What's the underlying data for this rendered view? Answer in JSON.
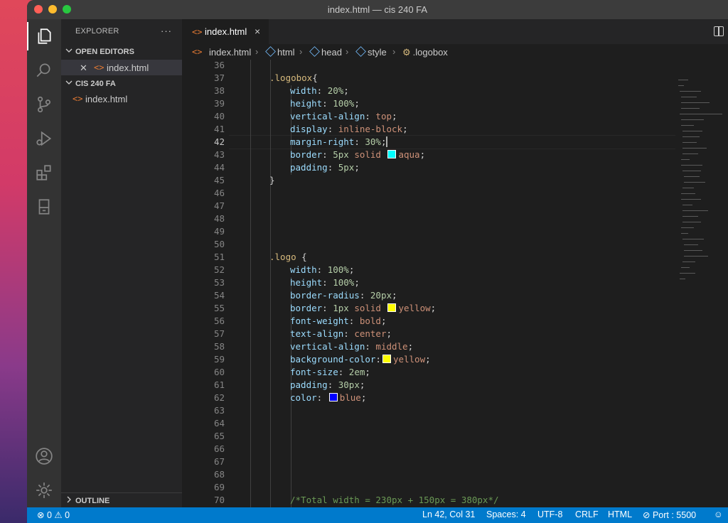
{
  "window": {
    "title": "index.html — cis 240 FA"
  },
  "activity_bar": {
    "items": [
      {
        "icon": "files-icon"
      },
      {
        "icon": "search-icon"
      },
      {
        "icon": "source-control-icon"
      },
      {
        "icon": "run-debug-icon"
      },
      {
        "icon": "extensions-icon"
      },
      {
        "icon": "remote-explorer-icon"
      }
    ],
    "bottom": [
      {
        "icon": "account-icon"
      },
      {
        "icon": "settings-gear-icon"
      }
    ]
  },
  "sidebar": {
    "title": "EXPLORER",
    "more": "···",
    "open_editors": {
      "label": "OPEN EDITORS",
      "files": [
        {
          "name": "index.html"
        }
      ]
    },
    "folder": {
      "label": "CIS 240 FA",
      "files": [
        {
          "name": "index.html"
        }
      ]
    },
    "outline": {
      "label": "OUTLINE"
    }
  },
  "tabs": [
    {
      "label": "index.html",
      "close": "×"
    }
  ],
  "breadcrumb": [
    "index.html",
    "html",
    "head",
    "style",
    ".logobox"
  ],
  "code": {
    "current_line": 42,
    "lines": [
      {
        "n": "36",
        "parts": []
      },
      {
        "n": "37",
        "parts": [
          [
            "sel",
            ".logobox"
          ],
          [
            "brace",
            "{"
          ]
        ]
      },
      {
        "n": "38",
        "parts": [
          [
            "prop",
            "width"
          ],
          [
            "brace",
            ": "
          ],
          [
            "num",
            "20%"
          ],
          [
            "brace",
            ";"
          ]
        ]
      },
      {
        "n": "39",
        "parts": [
          [
            "prop",
            "height"
          ],
          [
            "brace",
            ": "
          ],
          [
            "num",
            "100%"
          ],
          [
            "brace",
            ";"
          ]
        ]
      },
      {
        "n": "40",
        "parts": [
          [
            "prop",
            "vertical-align"
          ],
          [
            "brace",
            ": "
          ],
          [
            "val",
            "top"
          ],
          [
            "brace",
            ";"
          ]
        ]
      },
      {
        "n": "41",
        "parts": [
          [
            "prop",
            "display"
          ],
          [
            "brace",
            ": "
          ],
          [
            "val",
            "inline-block"
          ],
          [
            "brace",
            ";"
          ]
        ]
      },
      {
        "n": "42",
        "parts": [
          [
            "prop",
            "margin-right"
          ],
          [
            "brace",
            ": "
          ],
          [
            "num",
            "30%"
          ],
          [
            "brace",
            ";"
          ],
          [
            "cursor",
            ""
          ]
        ]
      },
      {
        "n": "43",
        "parts": [
          [
            "prop",
            "border"
          ],
          [
            "brace",
            ": "
          ],
          [
            "num",
            "5px"
          ],
          [
            "brace",
            " "
          ],
          [
            "val",
            "solid "
          ],
          [
            "swatch",
            "#00ffff"
          ],
          [
            "val",
            "aqua"
          ],
          [
            "brace",
            ";"
          ]
        ]
      },
      {
        "n": "44",
        "parts": [
          [
            "prop",
            "padding"
          ],
          [
            "brace",
            ": "
          ],
          [
            "num",
            "5px"
          ],
          [
            "brace",
            ";"
          ]
        ]
      },
      {
        "n": "45",
        "parts": [
          [
            "brace",
            "}"
          ]
        ]
      },
      {
        "n": "46",
        "parts": []
      },
      {
        "n": "47",
        "parts": []
      },
      {
        "n": "48",
        "parts": []
      },
      {
        "n": "49",
        "parts": []
      },
      {
        "n": "50",
        "parts": []
      },
      {
        "n": "51",
        "parts": [
          [
            "sel",
            ".logo "
          ],
          [
            "brace",
            "{"
          ]
        ]
      },
      {
        "n": "52",
        "parts": [
          [
            "prop",
            "width"
          ],
          [
            "brace",
            ": "
          ],
          [
            "num",
            "100%"
          ],
          [
            "brace",
            ";"
          ]
        ]
      },
      {
        "n": "53",
        "parts": [
          [
            "prop",
            "height"
          ],
          [
            "brace",
            ": "
          ],
          [
            "num",
            "100%"
          ],
          [
            "brace",
            ";"
          ]
        ]
      },
      {
        "n": "54",
        "parts": [
          [
            "prop",
            "border-radius"
          ],
          [
            "brace",
            ": "
          ],
          [
            "num",
            "20px"
          ],
          [
            "brace",
            ";"
          ]
        ]
      },
      {
        "n": "55",
        "parts": [
          [
            "prop",
            "border"
          ],
          [
            "brace",
            ": "
          ],
          [
            "num",
            "1px"
          ],
          [
            "brace",
            " "
          ],
          [
            "val",
            "solid "
          ],
          [
            "swatch",
            "#ffff00"
          ],
          [
            "val",
            "yellow"
          ],
          [
            "brace",
            ";"
          ]
        ]
      },
      {
        "n": "56",
        "parts": [
          [
            "prop",
            "font-weight"
          ],
          [
            "brace",
            ": "
          ],
          [
            "val",
            "bold"
          ],
          [
            "brace",
            ";"
          ]
        ]
      },
      {
        "n": "57",
        "parts": [
          [
            "prop",
            "text-align"
          ],
          [
            "brace",
            ": "
          ],
          [
            "val",
            "center"
          ],
          [
            "brace",
            ";"
          ]
        ]
      },
      {
        "n": "58",
        "parts": [
          [
            "prop",
            "vertical-align"
          ],
          [
            "brace",
            ": "
          ],
          [
            "val",
            "middle"
          ],
          [
            "brace",
            ";"
          ]
        ]
      },
      {
        "n": "59",
        "parts": [
          [
            "prop",
            "background-color"
          ],
          [
            "brace",
            ":"
          ],
          [
            "swatch",
            "#ffff00"
          ],
          [
            "val",
            "yellow"
          ],
          [
            "brace",
            ";"
          ]
        ]
      },
      {
        "n": "60",
        "parts": [
          [
            "prop",
            "font-size"
          ],
          [
            "brace",
            ": "
          ],
          [
            "num",
            "2em"
          ],
          [
            "brace",
            ";"
          ]
        ]
      },
      {
        "n": "61",
        "parts": [
          [
            "prop",
            "padding"
          ],
          [
            "brace",
            ": "
          ],
          [
            "num",
            "30px"
          ],
          [
            "brace",
            ";"
          ]
        ]
      },
      {
        "n": "62",
        "parts": [
          [
            "prop",
            "color"
          ],
          [
            "brace",
            ": "
          ],
          [
            "swatch",
            "#0000ff"
          ],
          [
            "val",
            "blue"
          ],
          [
            "brace",
            ";"
          ]
        ]
      },
      {
        "n": "63",
        "parts": []
      },
      {
        "n": "64",
        "parts": []
      },
      {
        "n": "65",
        "parts": []
      },
      {
        "n": "66",
        "parts": []
      },
      {
        "n": "67",
        "parts": []
      },
      {
        "n": "68",
        "parts": []
      },
      {
        "n": "69",
        "parts": []
      },
      {
        "n": "70",
        "parts": [
          [
            "cmt",
            "/*Total width = 230px + 150px = 380px*/"
          ]
        ]
      }
    ]
  },
  "statusbar": {
    "errors": "0",
    "warnings": "0",
    "position": "Ln 42, Col 31",
    "spaces": "Spaces: 4",
    "encoding": "UTF-8",
    "eol": "CRLF",
    "language": "HTML",
    "port": "Port : 5500"
  },
  "colors": {
    "accent": "#007acc",
    "editor_bg": "#1e1e1e",
    "sidebar_bg": "#252526"
  }
}
